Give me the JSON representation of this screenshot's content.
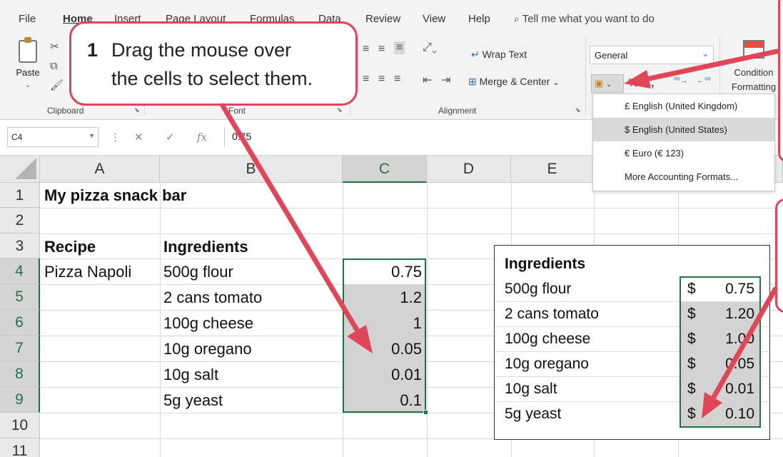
{
  "menu": {
    "tabs": [
      "File",
      "Home",
      "Insert",
      "Page Layout",
      "Formulas",
      "Data",
      "Review",
      "View",
      "Help"
    ],
    "tell_me": "Tell me what you want to do"
  },
  "ribbon": {
    "paste_label": "Paste",
    "groups": {
      "clipboard": "Clipboard",
      "font": "Font",
      "alignment": "Alignment"
    },
    "wrap_text": "Wrap Text",
    "merge_center": "Merge & Center",
    "number_format": "General",
    "conditional_formatting": "Condition\nFormatting",
    "currency_options": [
      "£ English (United Kingdom)",
      "$ English (United States)",
      "€ Euro (€ 123)",
      "More Accounting Formats..."
    ]
  },
  "formula_bar": {
    "name_box": "C4",
    "formula": "0.75"
  },
  "columns": [
    "A",
    "B",
    "C",
    "D",
    "E"
  ],
  "rows": [
    "1",
    "2",
    "3",
    "4",
    "5",
    "6",
    "7",
    "8",
    "9",
    "10",
    "11"
  ],
  "sheet": {
    "title": "My pizza snack bar",
    "recipe_header": "Recipe",
    "ingredients_header": "Ingredients",
    "recipe": "Pizza Napoli",
    "ingredients": [
      "500g flour",
      "2 cans tomato",
      "100g cheese",
      "10g oregano",
      "10g salt",
      "5g yeast"
    ],
    "prices": [
      "0.75",
      "1.2",
      "1",
      "0.05",
      "0.01",
      "0.1"
    ]
  },
  "inset": {
    "header": "Ingredients",
    "ingredients": [
      "500g flour",
      "2 cans tomato",
      "100g cheese",
      "10g oregano",
      "10g salt",
      "5g yeast"
    ],
    "currency_symbol": "$",
    "prices": [
      "0.75",
      "1.20",
      "1.00",
      "0.05",
      "0.01",
      "0.10"
    ]
  },
  "callout": {
    "number": "1",
    "line1": "Drag the mouse over",
    "line2": "the cells to select them."
  },
  "colors": {
    "callout": "#e04658",
    "excel_green": "#217346"
  }
}
